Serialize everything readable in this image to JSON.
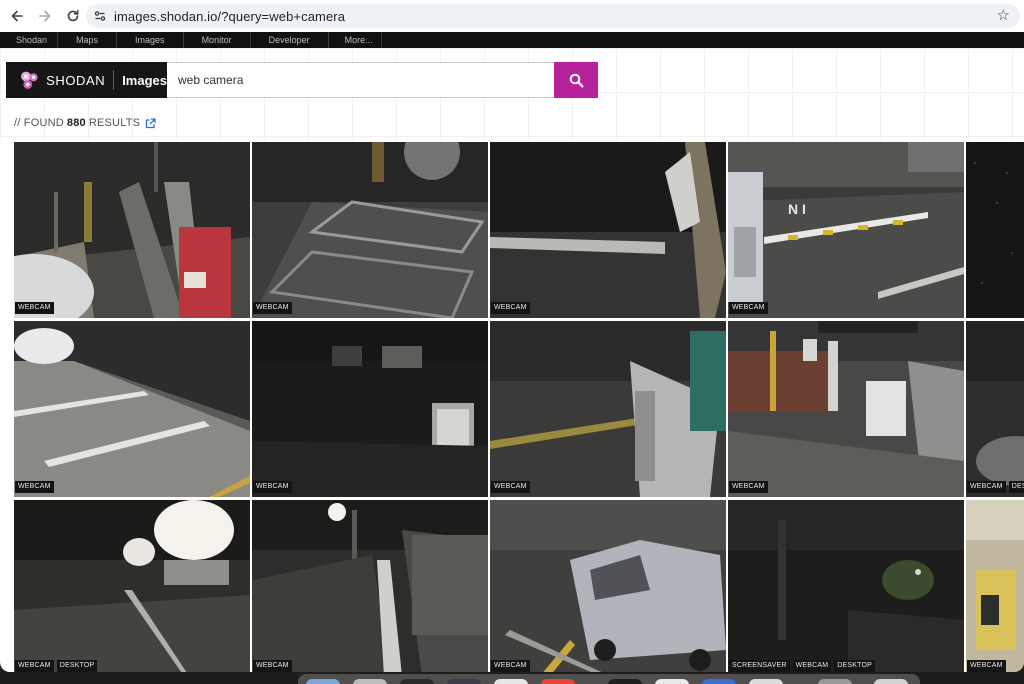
{
  "browser": {
    "url": "images.shodan.io/?query=web+camera"
  },
  "nav": {
    "items": [
      "Shodan",
      "Maps",
      "Images",
      "Monitor",
      "Developer",
      "More..."
    ]
  },
  "brand": {
    "name": "SHODAN",
    "sub": "Images"
  },
  "search": {
    "value": "web camera"
  },
  "results": {
    "prefix": "// FOUND",
    "count": "880",
    "suffix": "RESULTS"
  },
  "grid": {
    "cells": [
      {
        "tags": [
          "WEBCAM"
        ]
      },
      {
        "tags": [
          "WEBCAM"
        ]
      },
      {
        "tags": [
          "WEBCAM"
        ]
      },
      {
        "tags": [
          "WEBCAM"
        ]
      },
      {
        "tags": []
      },
      {
        "tags": [
          "WEBCAM"
        ]
      },
      {
        "tags": [
          "WEBCAM"
        ]
      },
      {
        "tags": [
          "WEBCAM"
        ]
      },
      {
        "tags": [
          "WEBCAM"
        ]
      },
      {
        "tags": [
          "WEBCAM",
          "DESKTOP"
        ]
      },
      {
        "tags": [
          "WEBCAM",
          "DESKTOP"
        ]
      },
      {
        "tags": [
          "WEBCAM"
        ]
      },
      {
        "tags": [
          "WEBCAM"
        ]
      },
      {
        "tags": [
          "SCREENSAVER",
          "WEBCAM",
          "DESKTOP"
        ]
      },
      {
        "tags": [
          "WEBCAM"
        ]
      }
    ]
  },
  "colors": {
    "accent": "#b7219c",
    "nav_bg": "#111111",
    "brand_bg": "#161616"
  }
}
